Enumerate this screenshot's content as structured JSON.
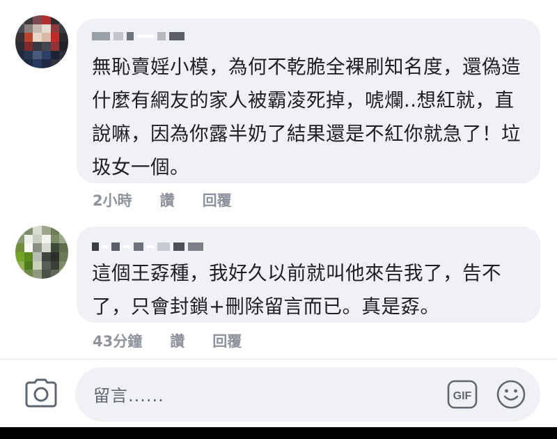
{
  "comments": [
    {
      "text": "無恥賣婬小模，為何不乾脆全裸刷知名度，還偽造什麼有網友的家人被霸凌死掉，唬爛..想紅就，直說嘛，因為你露半奶了結果還是不紅你就急了！垃圾女一個。",
      "time": "2小時",
      "like_label": "讚",
      "reply_label": "回覆"
    },
    {
      "text": "這個王孬種，我好久以前就叫他來告我了，告不了，只會封鎖+刪除留言而已。真是孬。",
      "time": "43分鐘",
      "like_label": "讚",
      "reply_label": "回覆"
    }
  ],
  "composer": {
    "placeholder": "留言......",
    "gif_label": "GIF",
    "camera_icon": "camera-icon",
    "emoji_icon": "smiley-icon"
  },
  "colors": {
    "bubble": "#f0f1f4",
    "text": "#1c1e21",
    "meta": "#8d939b"
  }
}
